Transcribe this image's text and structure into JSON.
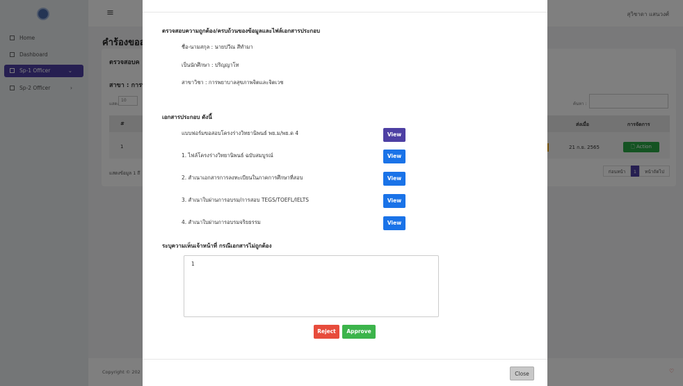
{
  "sidebar": {
    "items": [
      {
        "label": "Home",
        "icon": "grid-icon"
      },
      {
        "label": "Dashboard",
        "icon": "grid-icon"
      },
      {
        "label": "Sp-1 Officer",
        "icon": "doc-icon",
        "active": true
      },
      {
        "label": "Sp-2 Officer",
        "icon": "doc-icon"
      }
    ]
  },
  "topbar": {
    "user_name": "สุวิชาดา แสนวงศ์"
  },
  "page": {
    "title": "คำร้องขอส",
    "card_header": "ตรวจสอบค",
    "subheading": "สาขา : การพ",
    "show_label": "แสดง",
    "show_value": "10",
    "search_label": "ค้นหา :",
    "columns": [
      "#",
      "ส่งเมื่อ",
      "การจัดการ"
    ],
    "row": {
      "index": "1",
      "date": "21 ก.ย. 2565",
      "action_label": "Action"
    },
    "info_label": "แสดงข้อมูล 1 ถึ",
    "pager": {
      "prev": "ก่อนหน้า",
      "current": "1",
      "next": "หน้าถัดไป"
    },
    "copyright": "Copyright © 202"
  },
  "modal": {
    "section_verify": "ตรวจสอบความถูกต้อง/ครบถ้วนของข้อมูลและไฟล์เอกสารประกอบ",
    "fields": [
      "ชื่อ-นามสกุล : นายปวีณ สีทำมา",
      "เป็นนักศึกษา : ปริญญาโท",
      "สาขาวิชา : การพยาบาลสุขภาพจิตและจิตเวช"
    ],
    "section_docs": "เอกสารประกอบ ดังนี้",
    "documents": [
      "แบบฟอร์มขอสอบโครงร่างวิทยานิพนธ์ พย.ม/พย.ด 4",
      "1. ไฟล์โครงร่างวิทยานิพนธ์ ฉบับสมบูรณ์",
      "2. สำเนาเอกสารการลงทะเบียนในภาคการศึกษาที่สอบ",
      "3. สำเนาใบผ่านการอบรม/การสอบ TEGS/TOEFL/IELTS",
      "4. สำเนาใบผ่านการอบรมจริยธรรม"
    ],
    "view_label": "View",
    "comment_label": "ระบุความเห็นเจ้าหน้าที่ กรณีเอกสารไม่ถูกต้อง",
    "comment_value": "1",
    "reject_label": "Reject",
    "approve_label": "Approve",
    "close_label": "Close"
  }
}
